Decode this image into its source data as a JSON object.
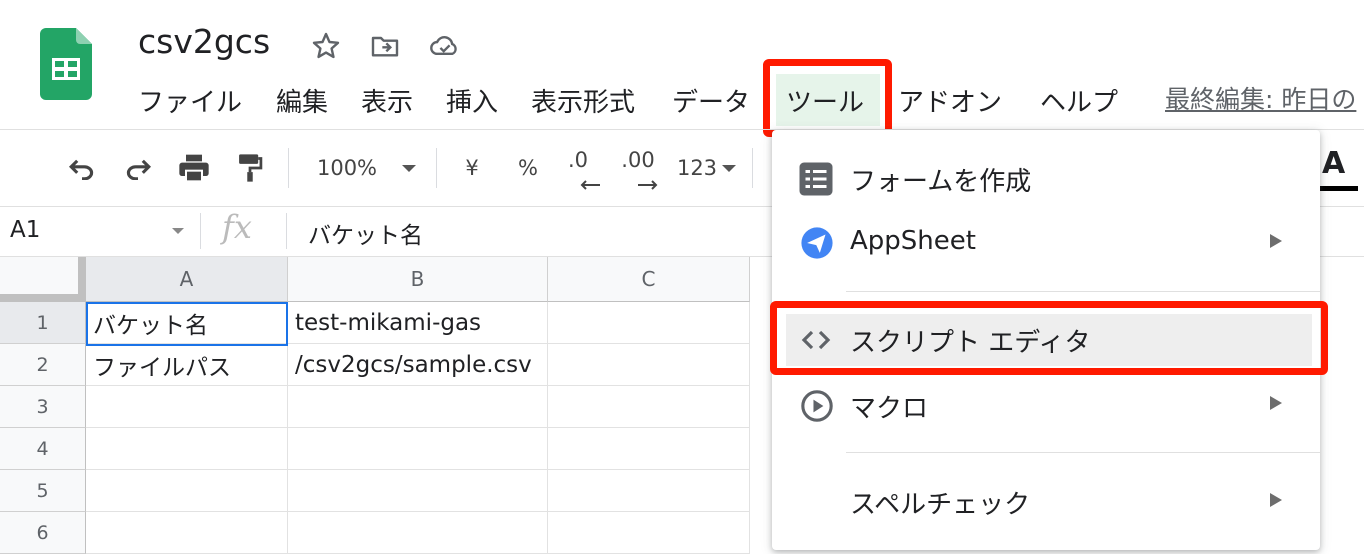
{
  "document": {
    "title": "csv2gcs",
    "last_edit": "最終編集: 昨日の"
  },
  "menu": {
    "items": [
      "ファイル",
      "編集",
      "表示",
      "挿入",
      "表示形式",
      "データ",
      "ツール",
      "アドオン",
      "ヘルプ"
    ],
    "active": "ツール"
  },
  "toolbar": {
    "zoom": "100%",
    "currency": "¥",
    "percent": "%",
    "decimal_decrease": ".0",
    "decimal_increase": ".00",
    "number_format": "123",
    "text_color": "A"
  },
  "formula_bar": {
    "name_box": "A1",
    "fx": "fx",
    "value": "バケット名"
  },
  "grid": {
    "columns": [
      "A",
      "B",
      "C"
    ],
    "rows": [
      "1",
      "2",
      "3",
      "4",
      "5",
      "6"
    ],
    "cells": [
      [
        "バケット名",
        "test-mikami-gas",
        ""
      ],
      [
        "ファイルパス",
        "/csv2gcs/sample.csv",
        ""
      ],
      [
        "",
        "",
        ""
      ],
      [
        "",
        "",
        ""
      ],
      [
        "",
        "",
        ""
      ],
      [
        "",
        "",
        ""
      ]
    ],
    "selected_cell": "A1"
  },
  "tools_dropdown": {
    "items": [
      {
        "label": "フォームを作成",
        "icon": "form-icon",
        "submenu": false
      },
      {
        "label": "AppSheet",
        "icon": "appsheet-icon",
        "submenu": true
      },
      {
        "label": "スクリプト エディタ",
        "icon": "code-icon",
        "submenu": false
      },
      {
        "label": "マクロ",
        "icon": "play-circle-icon",
        "submenu": true
      },
      {
        "label": "スペルチェック",
        "icon": "",
        "submenu": true
      }
    ],
    "highlighted": "スクリプト エディタ"
  },
  "colors": {
    "sheets_green": "#23a566",
    "highlight_red": "#ff1a00",
    "selection_blue": "#1a73e8",
    "active_menu_bg": "#e6f4ea"
  }
}
